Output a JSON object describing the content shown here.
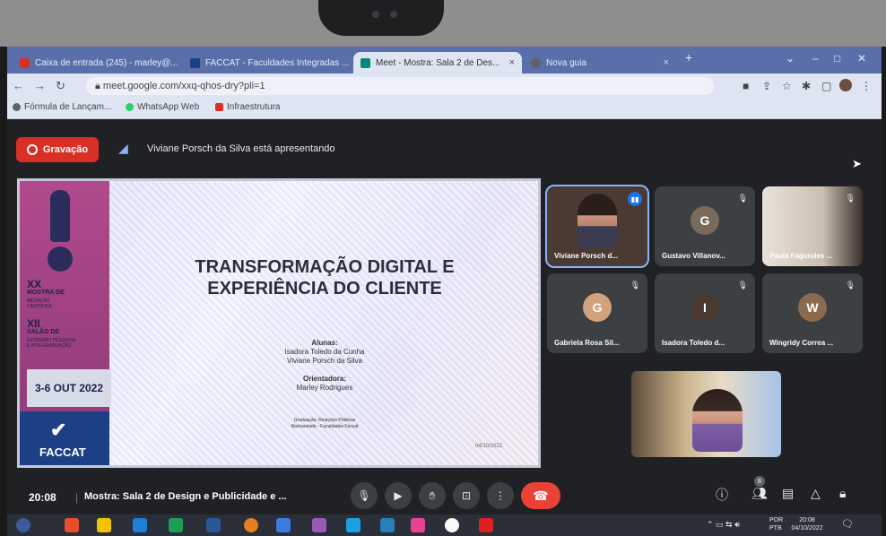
{
  "browser": {
    "tabs": [
      {
        "label": "Caixa de entrada (245) - marley@...",
        "active": false,
        "color": "#d93025"
      },
      {
        "label": "FACCAT - Faculdades Integradas ...",
        "active": false,
        "color": "#1c3f86"
      },
      {
        "label": "Meet - Mostra: Sala 2 de Des...",
        "active": true,
        "color": "#00897b"
      },
      {
        "label": "Nova guia",
        "active": false,
        "color": "#5f6368"
      }
    ],
    "tab_close": "×",
    "new_tab": "+",
    "url": "meet.google.com/xxq-qhos-dry?pli=1",
    "bookmarks": [
      {
        "label": "Fórmula de Lançam...",
        "color": "#5f6368"
      },
      {
        "label": "WhatsApp Web",
        "color": "#25d366"
      },
      {
        "label": "Infraestrutura",
        "color": "#d93025"
      }
    ]
  },
  "meet": {
    "record_label": "Gravação",
    "presenting_text": "Viviane Porsch da Silva está apresentando",
    "slide": {
      "title_line1": "TRANSFORMAÇÃO DIGITAL E",
      "title_line2": "EXPERIÊNCIA DO CLIENTE",
      "students_heading": "Alunas:",
      "student1": "Isadora Toledo da Cunha",
      "student2": "Viviane Porsch da Silva",
      "advisor_heading": "Orientadora:",
      "advisor": "Marley Rodrigues",
      "course_line1": "Graduação: Relações Públicas",
      "course_line2": "Bacharelado - Faculdades Faccat",
      "corner": "04/10/2022",
      "side_xx": "XX",
      "side_mostra": "MOSTRA DE",
      "side_mostra_sub": "INICIAÇÃO CIENTÍFICA",
      "side_xii": "XII",
      "side_salao": "SALÃO DE",
      "side_salao_sub": "EXTENSÃO PESQUISA E PÓS-GRADUAÇÃO",
      "date": "3-6 OUT 2022",
      "brand": "FACCAT"
    },
    "participants": [
      {
        "name": "Viviane Porsch d...",
        "speaking": true,
        "muted": false,
        "color": "#6b4e3d"
      },
      {
        "name": "Gustavo Villanov...",
        "speaking": false,
        "muted": true,
        "color": "#7a6a5c"
      },
      {
        "name": "Paula Fagundes ...",
        "speaking": false,
        "muted": true,
        "color": "#c9b7a6"
      },
      {
        "name": "Gabriela Rosa Sil...",
        "speaking": false,
        "muted": true,
        "color": "#d1a27b"
      },
      {
        "name": "Isadora Toledo d...",
        "speaking": false,
        "muted": true,
        "color": "#4a3a30"
      },
      {
        "name": "Wingridy Correa ...",
        "speaking": false,
        "muted": true,
        "color": "#8b6a4e"
      }
    ],
    "time": "20:08",
    "separator": "|",
    "meeting_name": "Mostra: Sala 2 de Design e Publicidade e ...",
    "participant_badge": "8"
  },
  "taskbar": {
    "lang_line1": "POR",
    "lang_line2": "PTB",
    "time": "20:08",
    "date": "04/10/2022"
  }
}
